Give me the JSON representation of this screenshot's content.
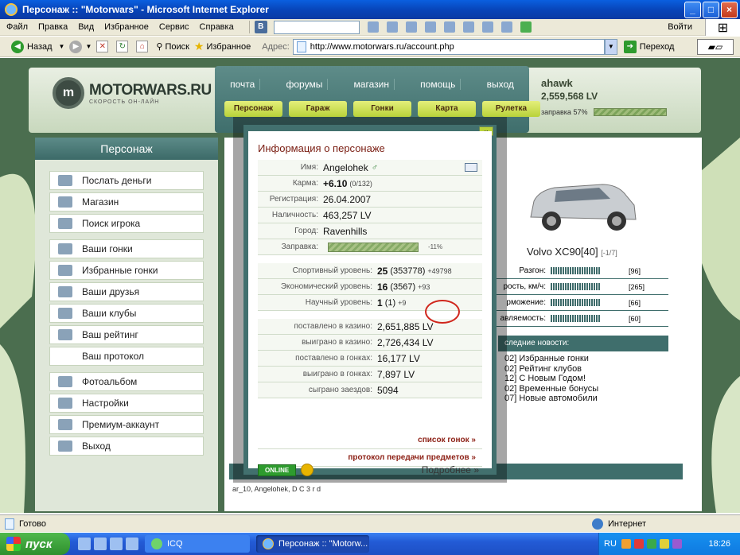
{
  "window": {
    "title": "Персонаж :: \"Motorwars\" - Microsoft Internet Explorer",
    "logo_glyph": "⊞"
  },
  "menubar": {
    "items": [
      "Файл",
      "Правка",
      "Вид",
      "Избранное",
      "Сервис",
      "Справка"
    ],
    "vk": "В",
    "login": "Войти"
  },
  "toolbar": {
    "back": "Назад",
    "search": "Поиск",
    "favorites": "Избранное",
    "address_label": "Адрес:",
    "url": "http://www.motorwars.ru/account.php",
    "go": "Переход"
  },
  "site": {
    "logo_name": "MOTORWARS.RU",
    "logo_slogan": "СКОРОСТЬ ОН-ЛАЙН",
    "logo_mark": "m",
    "nav": [
      "почта",
      "форумы",
      "магазин",
      "помощь",
      "выход"
    ],
    "nav_yellow": [
      "Персонаж",
      "Гараж",
      "Гонки",
      "Карта",
      "Рулетка"
    ],
    "user": {
      "name": "ahawk",
      "money": "2,559,568 LV",
      "fuel_label": "заправка 57%",
      "fuel_level": 0.57
    }
  },
  "sidebar": {
    "title": "Персонаж",
    "groups": [
      [
        "Послать деньги",
        "Магазин",
        "Поиск игрока"
      ],
      [
        "Ваши гонки",
        "Избранные гонки",
        "Ваши друзья",
        "Ваши клубы",
        "Ваш рейтинг",
        "Ваш протокол"
      ],
      [
        "Фотоальбом",
        "Настройки",
        "Премиум-аккаунт",
        "Выход"
      ]
    ]
  },
  "car": {
    "name": "Volvo XC90[40]",
    "sub": "[-1/7]",
    "stats": [
      {
        "label": "Разгон:",
        "value": "[96]"
      },
      {
        "label": "рость, км/ч:",
        "value": "[265]"
      },
      {
        "label": "рможение:",
        "value": "[66]"
      },
      {
        "label": "авляемость:",
        "value": "[60]"
      }
    ]
  },
  "news": {
    "title": "следние новости:",
    "items": [
      "02] Избранные гонки",
      "02] Рейтинг клубов",
      "12] С Новым Годом!",
      "02] Временные бонусы",
      "07] Новые автомобили"
    ]
  },
  "bottom_text": "ar_10, Angelohek, D C 3 r d",
  "modal": {
    "close": "x",
    "title": "Информация о персонаже",
    "rows": [
      {
        "k": "Имя:",
        "v": "Angelohek"
      },
      {
        "k": "Карма:",
        "v": "+6.10",
        "sub": "(0/132)"
      },
      {
        "k": "Регистрация:",
        "v": "26.04.2007"
      },
      {
        "k": "Наличность:",
        "v": "463,257 LV"
      },
      {
        "k": "Город:",
        "v": "Ravenhills"
      },
      {
        "k": "Заправка:",
        "v": "-11%",
        "level": 0.89
      }
    ],
    "levels": [
      {
        "k": "Спортивный уровень:",
        "v": "25",
        "paren": "(353778)",
        "extra": "+49798"
      },
      {
        "k": "Экономический уровень:",
        "v": "16",
        "paren": "(3567)",
        "extra": "+93"
      },
      {
        "k": "Научный уровень:",
        "v": "1",
        "paren": "(1)",
        "extra": "+9"
      }
    ],
    "money": [
      {
        "k": "поставлено в казино:",
        "v": "2,651,885 LV"
      },
      {
        "k": "выиграно в казино:",
        "v": "2,726,434 LV"
      },
      {
        "k": "поставлено в гонках:",
        "v": "16,177 LV"
      },
      {
        "k": "выиграно в гонках:",
        "v": "7,897 LV"
      },
      {
        "k": "сыграно заездов:",
        "v": "5094"
      }
    ],
    "links": [
      "список гонок »",
      "протокол передачи предметов »"
    ],
    "online": "ONLINE",
    "more": "Подробнее »"
  },
  "statusbar": {
    "status": "Готово",
    "zone": "Интернет"
  },
  "taskbar": {
    "start": "пуск",
    "tasks": [
      "ICQ",
      "Персонаж :: \"Motorw..."
    ],
    "lang": "RU",
    "clock": "18:26"
  }
}
